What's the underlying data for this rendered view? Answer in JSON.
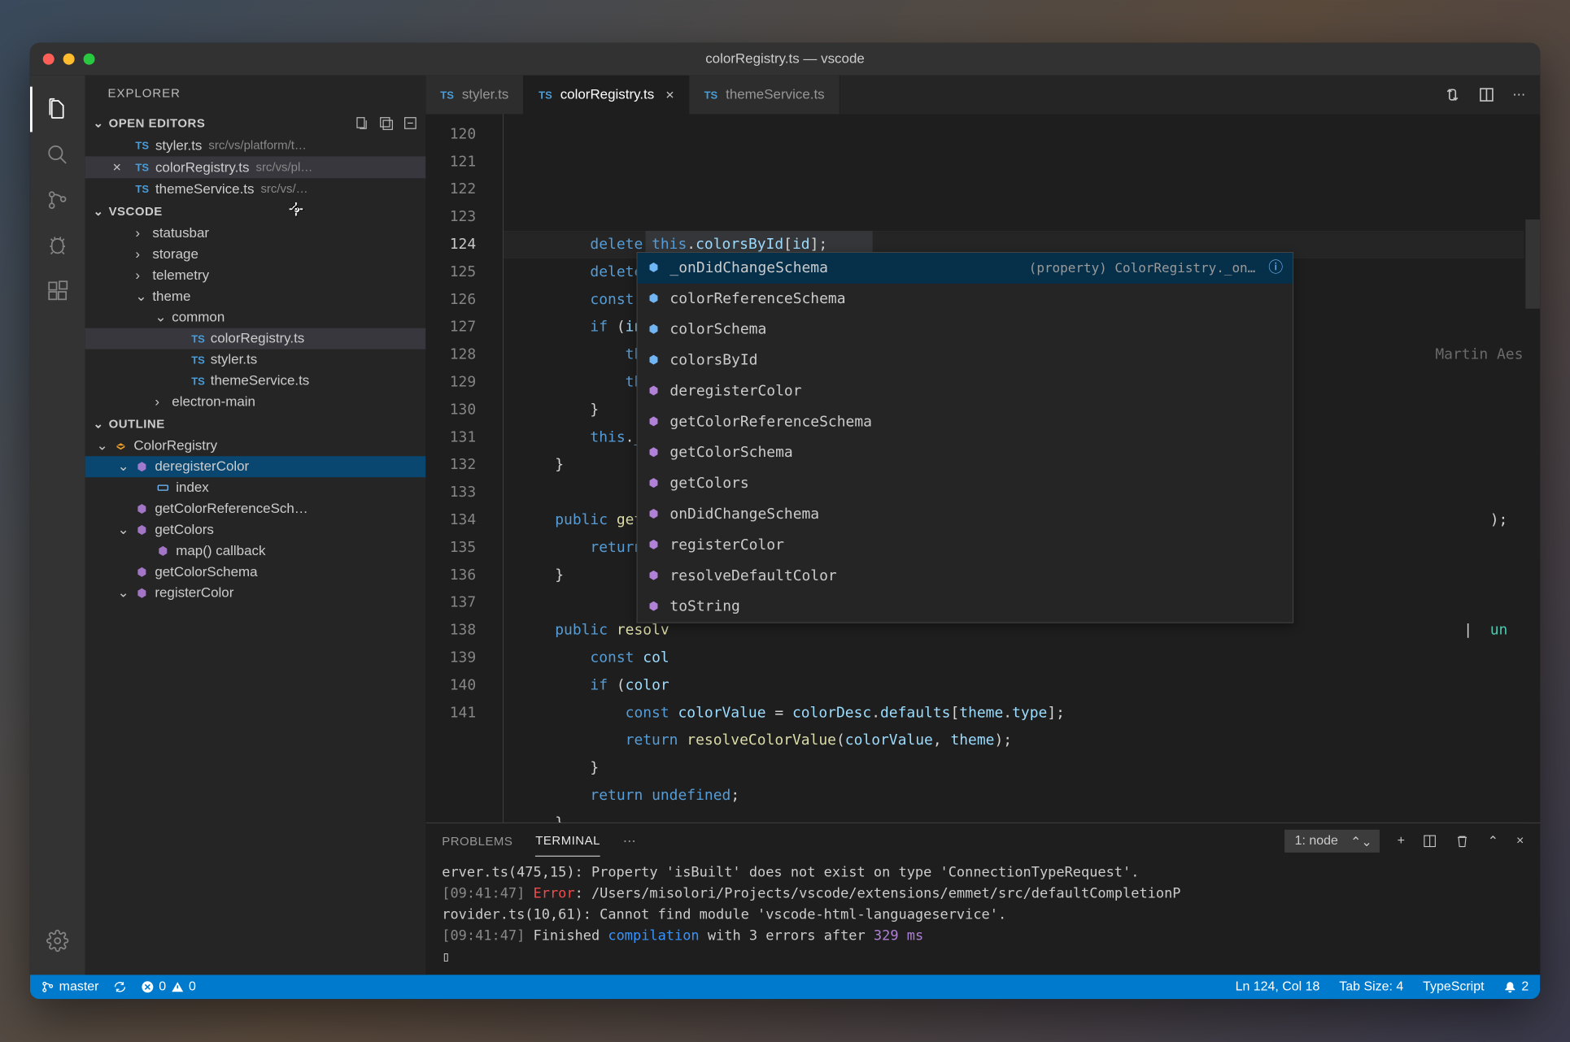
{
  "window": {
    "title": "colorRegistry.ts — vscode"
  },
  "sidebar": {
    "title": "EXPLORER",
    "openEditors": {
      "label": "OPEN EDITORS",
      "items": [
        {
          "name": "styler.ts",
          "path": "src/vs/platform/t…",
          "active": false
        },
        {
          "name": "colorRegistry.ts",
          "path": "src/vs/pl…",
          "active": true
        },
        {
          "name": "themeService.ts",
          "path": "src/vs/…",
          "active": false
        }
      ]
    },
    "workspace": {
      "label": "VSCODE",
      "tree": [
        {
          "name": "statusbar",
          "indent": 2,
          "chev": ">"
        },
        {
          "name": "storage",
          "indent": 2,
          "chev": ">"
        },
        {
          "name": "telemetry",
          "indent": 2,
          "chev": ">"
        },
        {
          "name": "theme",
          "indent": 2,
          "chev": "v"
        },
        {
          "name": "common",
          "indent": 3,
          "chev": "v"
        },
        {
          "name": "colorRegistry.ts",
          "indent": 4,
          "ts": true,
          "selected": true
        },
        {
          "name": "styler.ts",
          "indent": 4,
          "ts": true
        },
        {
          "name": "themeService.ts",
          "indent": 4,
          "ts": true
        },
        {
          "name": "electron-main",
          "indent": 3,
          "chev": ">"
        }
      ]
    },
    "outline": {
      "label": "OUTLINE",
      "items": [
        {
          "name": "ColorRegistry",
          "indent": 0,
          "kind": "class",
          "chev": "v"
        },
        {
          "name": "deregisterColor",
          "indent": 1,
          "kind": "method",
          "chev": "v",
          "selected": true
        },
        {
          "name": "index",
          "indent": 2,
          "kind": "var"
        },
        {
          "name": "getColorReferenceSch…",
          "indent": 1,
          "kind": "method"
        },
        {
          "name": "getColors",
          "indent": 1,
          "kind": "method",
          "chev": "v"
        },
        {
          "name": "map() callback",
          "indent": 2,
          "kind": "method"
        },
        {
          "name": "getColorSchema",
          "indent": 1,
          "kind": "method"
        },
        {
          "name": "registerColor",
          "indent": 1,
          "kind": "method",
          "chev": "v"
        }
      ]
    }
  },
  "tabs": [
    {
      "name": "styler.ts",
      "active": false
    },
    {
      "name": "colorRegistry.ts",
      "active": true,
      "close": true
    },
    {
      "name": "themeService.ts",
      "active": false
    }
  ],
  "editor": {
    "firstLine": 120,
    "lastLine": 141,
    "blame": "Martin Aesc",
    "lines": [
      "        delete this.colorsById[id];",
      "        delete this.colorSchema.properties[id];",
      "        const index = this.colorReferenceSchema.enum.indexOf(id);",
      "        if (index !== -1) {",
      "            this.colorReferenceSchema.enum.splice(index, 1);",
      "            this.",
      "        }",
      "        this._onD",
      "    }",
      "",
      "    public getCol",
      "        return Ob",
      "    }",
      "",
      "    public resolv",
      "        const col",
      "        if (color",
      "            const colorValue = colorDesc.defaults[theme.type];",
      "            return resolveColorValue(colorValue, theme);",
      "        }",
      "        return undefined;",
      "    }"
    ],
    "sideTokens": {
      "pipe": "|",
      "un": "un",
      "paren": ");"
    }
  },
  "suggest": {
    "detail": "(property) ColorRegistry._on…",
    "items": [
      {
        "label": "_onDidChangeSchema",
        "kind": "field",
        "selected": true
      },
      {
        "label": "colorReferenceSchema",
        "kind": "field"
      },
      {
        "label": "colorSchema",
        "kind": "field"
      },
      {
        "label": "colorsById",
        "kind": "field"
      },
      {
        "label": "deregisterColor",
        "kind": "method"
      },
      {
        "label": "getColorReferenceSchema",
        "kind": "method"
      },
      {
        "label": "getColorSchema",
        "kind": "method"
      },
      {
        "label": "getColors",
        "kind": "method"
      },
      {
        "label": "onDidChangeSchema",
        "kind": "method"
      },
      {
        "label": "registerColor",
        "kind": "method"
      },
      {
        "label": "resolveDefaultColor",
        "kind": "method"
      },
      {
        "label": "toString",
        "kind": "method"
      }
    ]
  },
  "panel": {
    "tabs": {
      "problems": "PROBLEMS",
      "terminal": "TERMINAL"
    },
    "terminalSelect": "1: node",
    "lines": [
      {
        "pre": "erver.ts(475,15): Property 'isBuilt' does not exist on type 'ConnectionTypeRequest'."
      },
      {
        "time": "[09:41:47]",
        "tag": "Error",
        "text": ": /Users/misolori/Projects/vscode/extensions/emmet/src/defaultCompletionP"
      },
      {
        "pre": "rovider.ts(10,61): Cannot find module 'vscode-html-languageservice'."
      },
      {
        "time": "[09:41:47]",
        "text2": " Finished ",
        "comp": "compilation",
        "text3": " with 3 errors after ",
        "ms": "329 ms"
      }
    ]
  },
  "status": {
    "branch": "master",
    "errors": "0",
    "warnings": "0",
    "lncol": "Ln 124, Col 18",
    "tabsize": "Tab Size: 4",
    "lang": "TypeScript",
    "bell": "2"
  }
}
